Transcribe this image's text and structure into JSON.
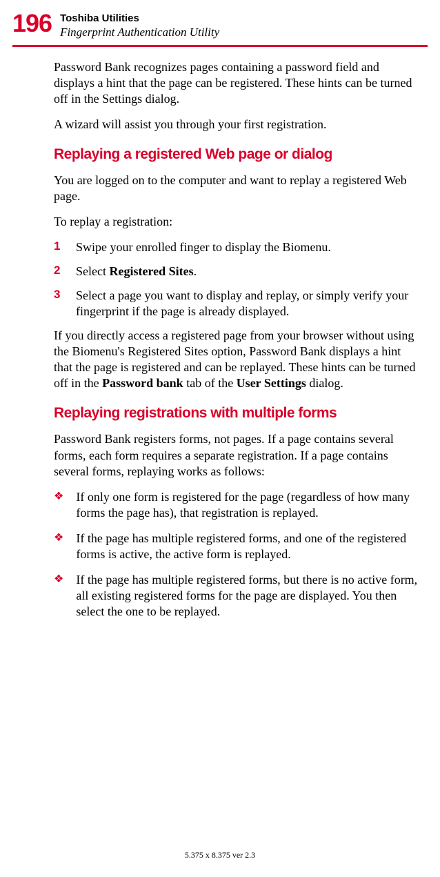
{
  "header": {
    "page_number": "196",
    "chapter": "Toshiba Utilities",
    "section": "Fingerprint Authentication Utility"
  },
  "p1": "Password Bank recognizes pages containing a password field and displays a hint that the page can be registered. These hints can be turned off in the Settings dialog.",
  "p2": "A wizard will assist you through your first registration.",
  "h1": "Replaying a registered Web page or dialog",
  "p3": "You are logged on to the computer and want to replay a registered Web page.",
  "p4": "To replay a registration:",
  "steps": [
    {
      "n": "1",
      "t": "Swipe your enrolled finger to display the Biomenu."
    },
    {
      "n": "2",
      "t_pre": "Select ",
      "t_bold": "Registered Sites",
      "t_post": "."
    },
    {
      "n": "3",
      "t": "Select a page you want to display and replay, or simply verify your fingerprint if the page is already displayed."
    }
  ],
  "p5_pre": "If you directly access a registered page from your browser without using the Biomenu's Registered Sites option, Password Bank displays a hint that the page is registered and can be replayed. These hints can be turned off in the ",
  "p5_b1": "Password bank",
  "p5_mid": " tab of the ",
  "p5_b2": "User Settings",
  "p5_post": " dialog.",
  "h2": "Replaying registrations with multiple forms",
  "p6": "Password Bank registers forms, not pages. If a page contains several forms, each form requires a separate registration. If a page contains several forms, replaying works as follows:",
  "bullets": [
    "If only one form is registered for the page (regardless of how many forms the page has), that registration is replayed.",
    "If the page has multiple registered forms, and one of the registered forms is active, the active form is replayed.",
    "If the page has multiple registered forms, but there is no active form, all existing registered forms for the page are displayed. You then select the one to be replayed."
  ],
  "footer": "5.375 x 8.375 ver 2.3"
}
